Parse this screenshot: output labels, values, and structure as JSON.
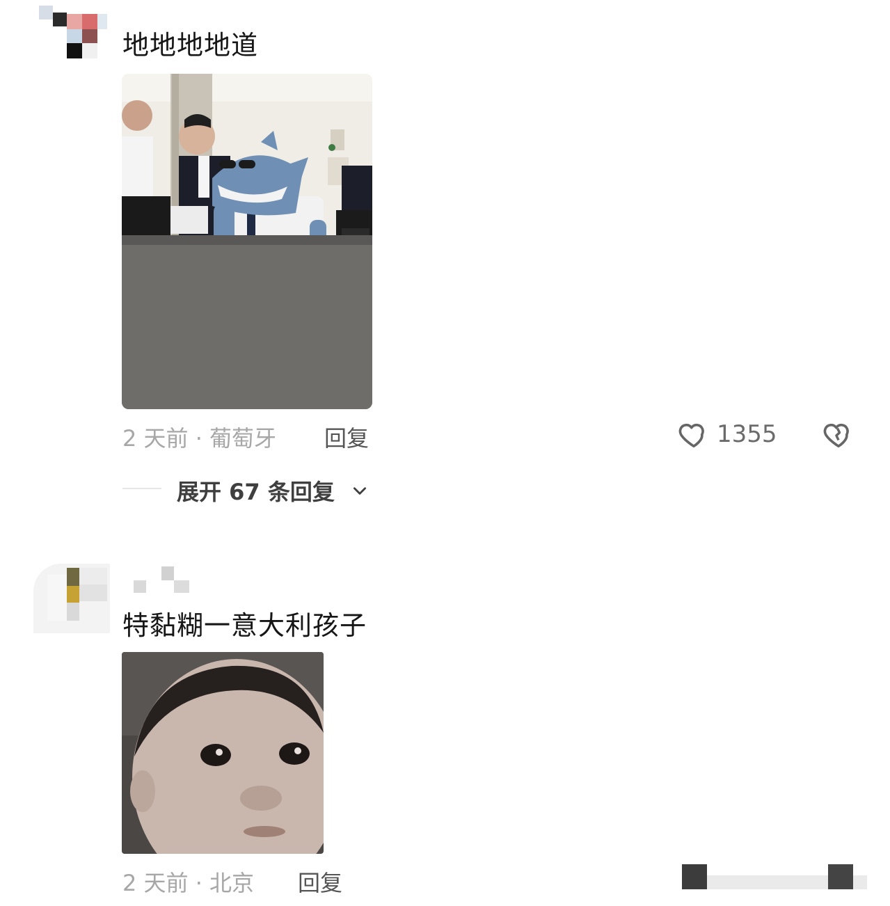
{
  "comments": [
    {
      "text": "地地地地道",
      "time_location": "2 天前 · 葡萄牙",
      "reply_label": "回复",
      "like_count": "1355",
      "expand_label": "展开 67 条回复"
    },
    {
      "text": "特黏糊一意大利孩子",
      "time_location": "2 天前 · 北京",
      "reply_label": "回复"
    }
  ],
  "icons": {
    "like": "heart-outline-icon",
    "dislike": "broken-heart-icon",
    "expand": "chevron-down-icon"
  },
  "colors": {
    "text": "#161616",
    "meta": "#a7a7a7",
    "reply": "#555555"
  }
}
